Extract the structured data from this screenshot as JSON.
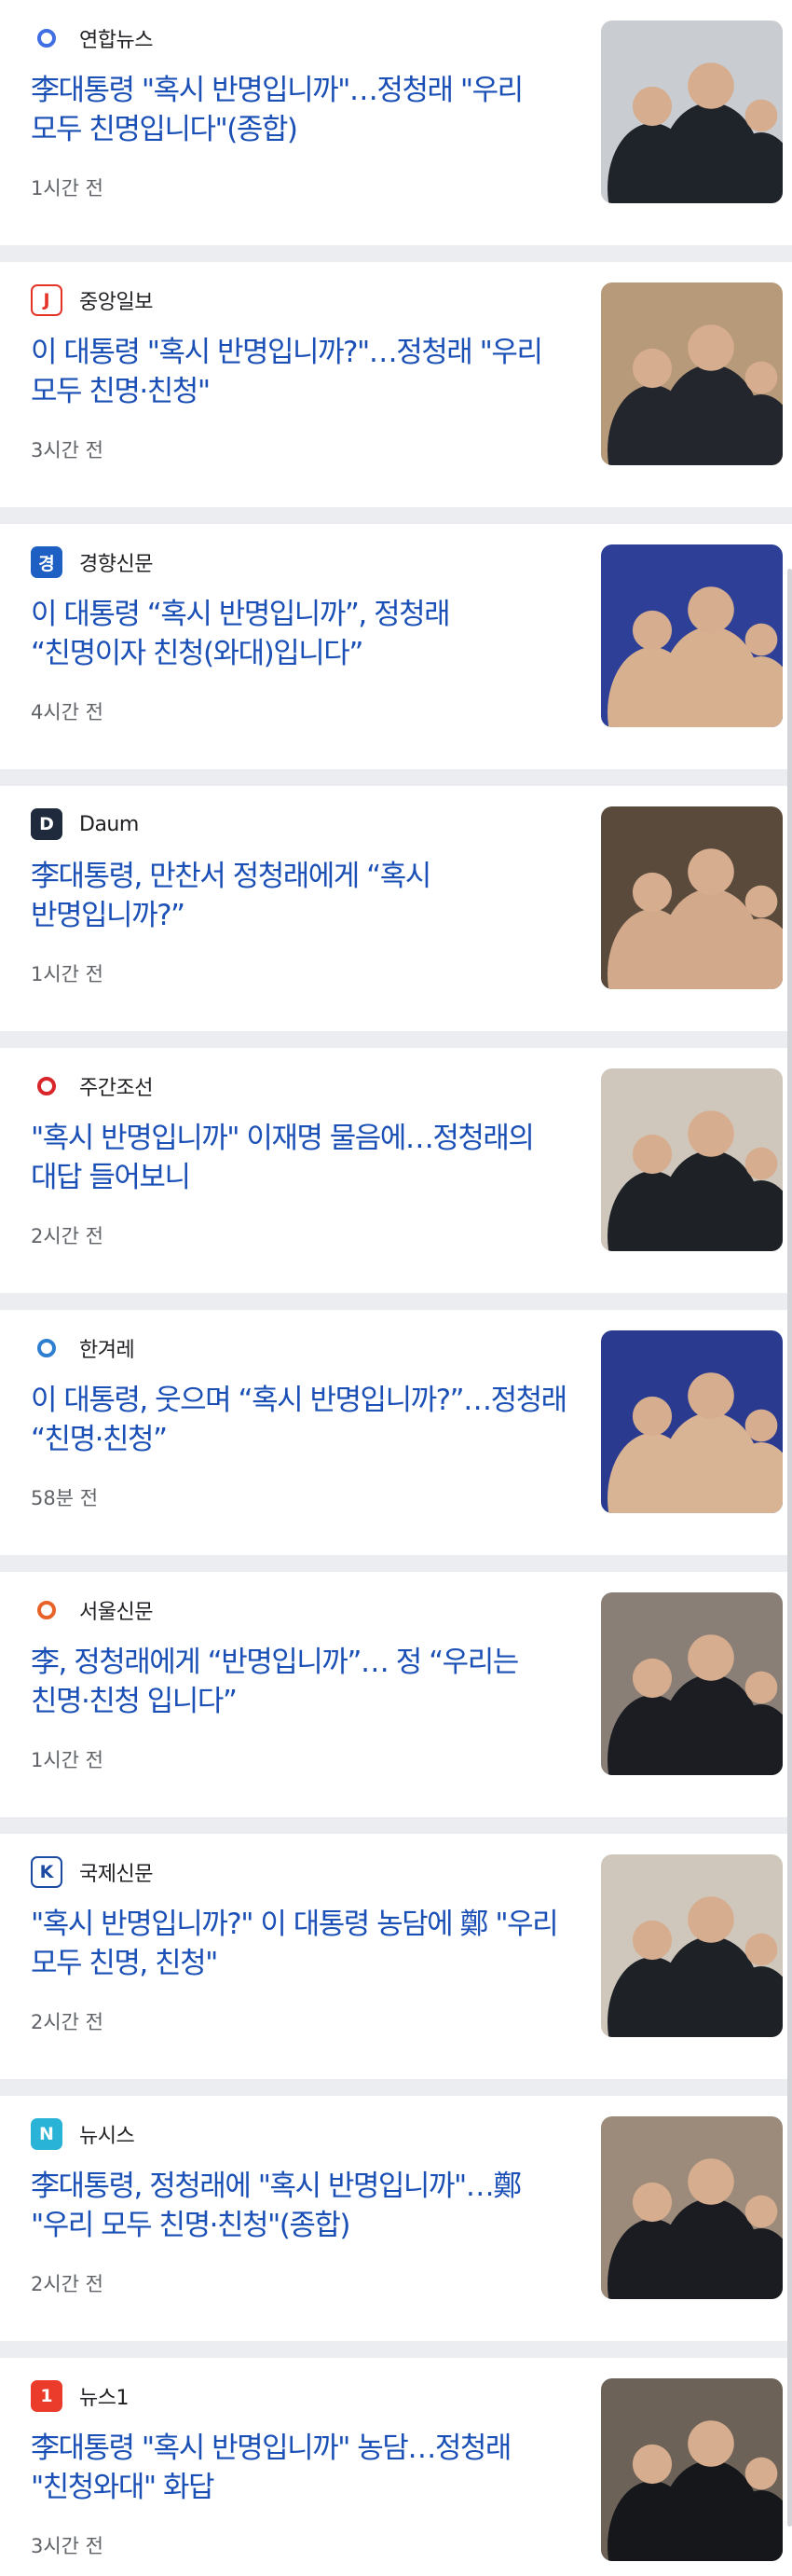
{
  "articles": [
    {
      "source": "연합뉴스",
      "logo_text": "",
      "logo_bg": "#ffffff",
      "logo_fg": "#3f6fe3",
      "title": "李대통령 \"혹시 반명입니까\"…정청래 \"우리 모두 친명입니다\"(종합)",
      "time": "1시간 전",
      "photo_bg": "#c9ccd1",
      "photo_fg": "#1f232a"
    },
    {
      "source": "중앙일보",
      "logo_text": "J",
      "logo_bg": "#ffffff",
      "logo_fg": "#e3342a",
      "title": "이 대통령 \"혹시 반명입니까?\"…정청래 \"우리 모두 친명·친청\"",
      "time": "3시간 전",
      "photo_bg": "#b79a7a",
      "photo_fg": "#23262d"
    },
    {
      "source": "경향신문",
      "logo_text": "경",
      "logo_bg": "#1d5fc2",
      "logo_fg": "#ffffff",
      "title": "이 대통령 “혹시 반명입니까”, 정청래 “친명이자 친청(와대)입니다”",
      "time": "4시간 전",
      "photo_bg": "#2d3f96",
      "photo_fg": "#d7b08f"
    },
    {
      "source": "Daum",
      "logo_text": "D",
      "logo_bg": "#1f2a3d",
      "logo_fg": "#ffffff",
      "title": "李대통령, 만찬서 정청래에게 “혹시 반명입니까?”",
      "time": "1시간 전",
      "photo_bg": "#5a4a3c",
      "photo_fg": "#d2a98b"
    },
    {
      "source": "주간조선",
      "logo_text": "",
      "logo_bg": "#ffffff",
      "logo_fg": "#d9262b",
      "title": "\"혹시 반명입니까\" 이재명 물음에…정청래의 대답 들어보니",
      "time": "2시간 전",
      "photo_bg": "#cfc7bc",
      "photo_fg": "#1e2227"
    },
    {
      "source": "한겨레",
      "logo_text": "",
      "logo_bg": "#ffffff",
      "logo_fg": "#2f7fd0",
      "title": "이 대통령, 웃으며 “혹시 반명입니까?”…정청래 “친명·친청”",
      "time": "58분 전",
      "photo_bg": "#2a3b8f",
      "photo_fg": "#d9b494"
    },
    {
      "source": "서울신문",
      "logo_text": "",
      "logo_bg": "#ffffff",
      "logo_fg": "#e8632a",
      "title": "李, 정청래에게 “반명입니까”… 정 “우리는 친명·친청 입니다”",
      "time": "1시간 전",
      "photo_bg": "#8a7f77",
      "photo_fg": "#1b1d22"
    },
    {
      "source": "국제신문",
      "logo_text": "K",
      "logo_bg": "#ffffff",
      "logo_fg": "#1c4aa3",
      "title": "\"혹시 반명입니까?\" 이 대통령 농담에 鄭 \"우리 모두 친명, 친청\"",
      "time": "2시간 전",
      "photo_bg": "#cfc7bc",
      "photo_fg": "#1e2227"
    },
    {
      "source": "뉴시스",
      "logo_text": "N",
      "logo_bg": "#29b3d6",
      "logo_fg": "#ffffff",
      "title": "李대통령, 정청래에 \"혹시 반명입니까\"…鄭 \"우리 모두 친명·친청\"(종합)",
      "time": "2시간 전",
      "photo_bg": "#9c8b7a",
      "photo_fg": "#1a1c22"
    },
    {
      "source": "뉴스1",
      "logo_text": "1",
      "logo_bg": "#ea3b2b",
      "logo_fg": "#ffffff",
      "title": "李대통령 \"혹시 반명입니까\" 농담…정청래 \"친청와대\" 화답",
      "time": "3시간 전",
      "photo_bg": "#6d6257",
      "photo_fg": "#15171b"
    }
  ]
}
